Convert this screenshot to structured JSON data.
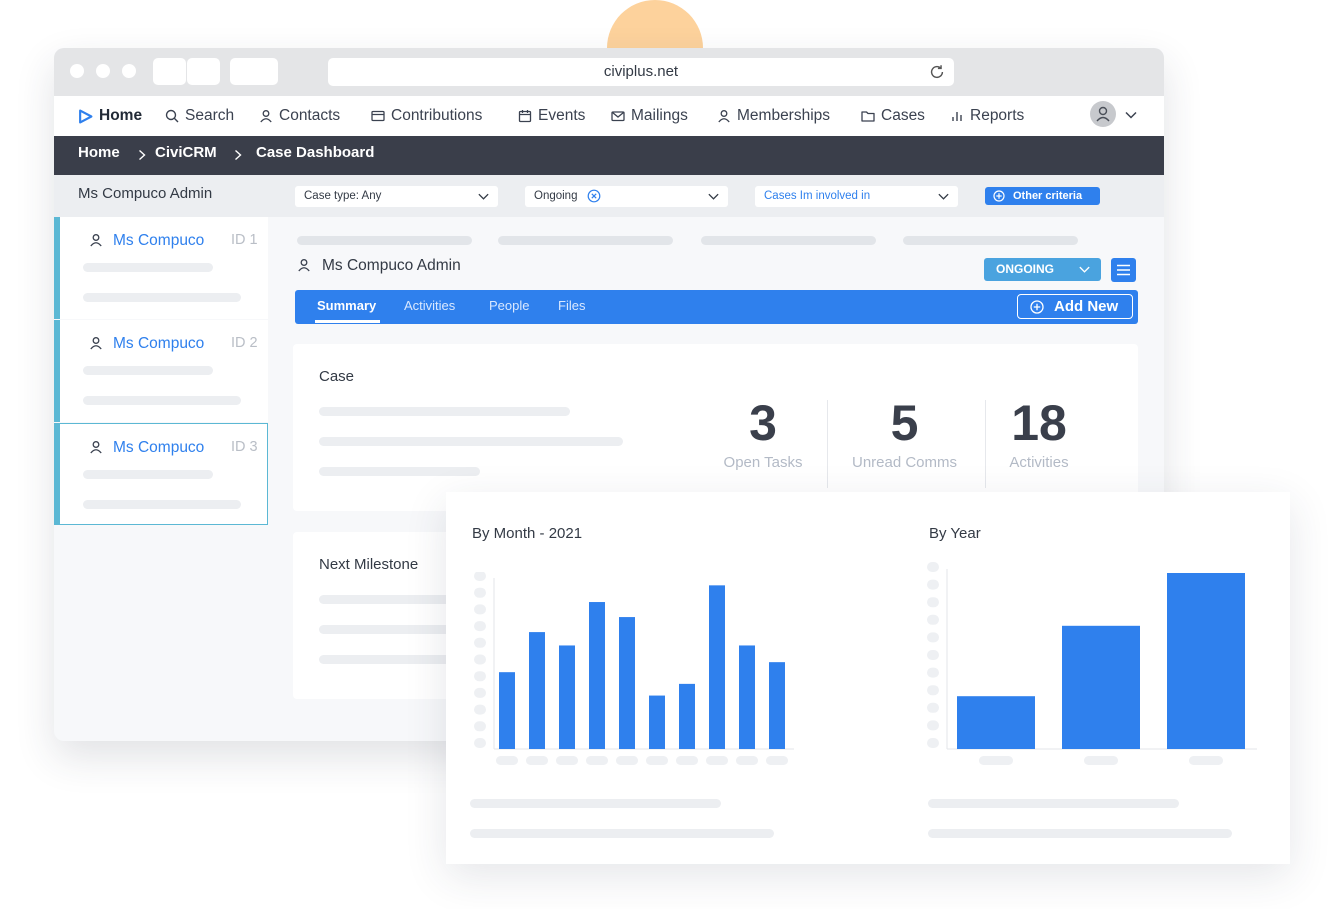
{
  "browser": {
    "url": "civiplus.net"
  },
  "nav": {
    "items": [
      {
        "label": "Home",
        "icon": "play-logo-icon"
      },
      {
        "label": "Search",
        "icon": "search-icon"
      },
      {
        "label": "Contacts",
        "icon": "user-icon"
      },
      {
        "label": "Contributions",
        "icon": "credit-card-icon"
      },
      {
        "label": "Events",
        "icon": "calendar-icon"
      },
      {
        "label": "Mailings",
        "icon": "mail-icon"
      },
      {
        "label": "Memberships",
        "icon": "user-icon"
      },
      {
        "label": "Cases",
        "icon": "folder-icon"
      },
      {
        "label": "Reports",
        "icon": "bar-chart-icon"
      }
    ]
  },
  "breadcrumb": [
    "Home",
    "CiviCRM",
    "Case Dashboard"
  ],
  "filters": {
    "title": "Ms Compuco Admin",
    "case_type": "Case type: Any",
    "status": "Ongoing",
    "involvement": "Cases Im involved in",
    "other_button": "Other criteria"
  },
  "sidebar": {
    "cards": [
      {
        "name": "Ms Compuco",
        "id": "ID 1"
      },
      {
        "name": "Ms Compuco",
        "id": "ID 2"
      },
      {
        "name": "Ms Compuco",
        "id": "ID 3"
      }
    ]
  },
  "main": {
    "title": "Ms Compuco Admin",
    "status_button": "ONGOING",
    "tabs": [
      "Summary",
      "Activities",
      "People",
      "Files"
    ],
    "add_new": "Add New"
  },
  "case": {
    "title": "Case",
    "stats": [
      {
        "value": "3",
        "label": "Open Tasks"
      },
      {
        "value": "5",
        "label": "Unread Comms"
      },
      {
        "value": "18",
        "label": "Activities"
      }
    ]
  },
  "milestone": {
    "title": "Next Milestone"
  },
  "colors": {
    "accent": "#2f80ed",
    "dark_bar": "#3a3e4a",
    "sidebar_accent": "#5bb8d4",
    "ongoing": "#4aa3df"
  },
  "chart_data": [
    {
      "type": "bar",
      "title": "By Month - 2021",
      "values": [
        46,
        70,
        62,
        88,
        79,
        32,
        39,
        98,
        62,
        52
      ],
      "ylim": [
        0,
        100
      ],
      "xlabel": "",
      "ylabel": "",
      "grid": false
    },
    {
      "type": "bar",
      "title": "By Year",
      "values": [
        30,
        70,
        100
      ],
      "ylim": [
        0,
        100
      ],
      "xlabel": "",
      "ylabel": "",
      "grid": false
    }
  ]
}
